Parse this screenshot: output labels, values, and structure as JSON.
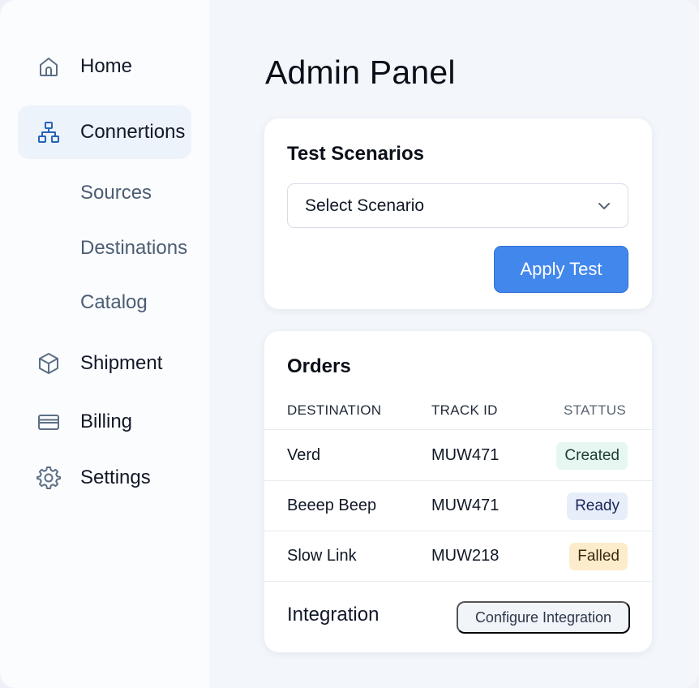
{
  "sidebar": {
    "items": [
      {
        "label": "Home",
        "icon": "home-icon"
      },
      {
        "label": "Connertions",
        "icon": "network-icon"
      },
      {
        "label": "Shipment",
        "icon": "box-icon"
      },
      {
        "label": "Billing",
        "icon": "card-icon"
      },
      {
        "label": "Settings",
        "icon": "gear-icon"
      }
    ],
    "subitems": [
      {
        "label": "Sources"
      },
      {
        "label": "Destinations"
      },
      {
        "label": "Catalog"
      }
    ],
    "active_color": "#2563b8"
  },
  "main": {
    "title": "Admin Panel",
    "scenarios": {
      "title": "Test Scenarios",
      "select_value": "Select Scenario",
      "apply_label": "Apply Test"
    },
    "orders": {
      "title": "Orders",
      "columns": [
        "DESTINATION",
        "TRACK ID",
        "STATTUS"
      ],
      "rows": [
        {
          "destination": "Verd",
          "track_id": "MUW471",
          "status": "Created"
        },
        {
          "destination": "Beeep Beep",
          "track_id": "MUW471",
          "status": "Ready"
        },
        {
          "destination": "Slow Link",
          "track_id": "MUW218",
          "status": "Falled"
        }
      ],
      "integration_label": "Integration",
      "configure_label": "Configure Integration"
    }
  },
  "colors": {
    "primary": "#4287ec",
    "created_bg": "#e6f6f1",
    "ready_bg": "#e8edfa",
    "failed_bg": "#fdeccc"
  }
}
